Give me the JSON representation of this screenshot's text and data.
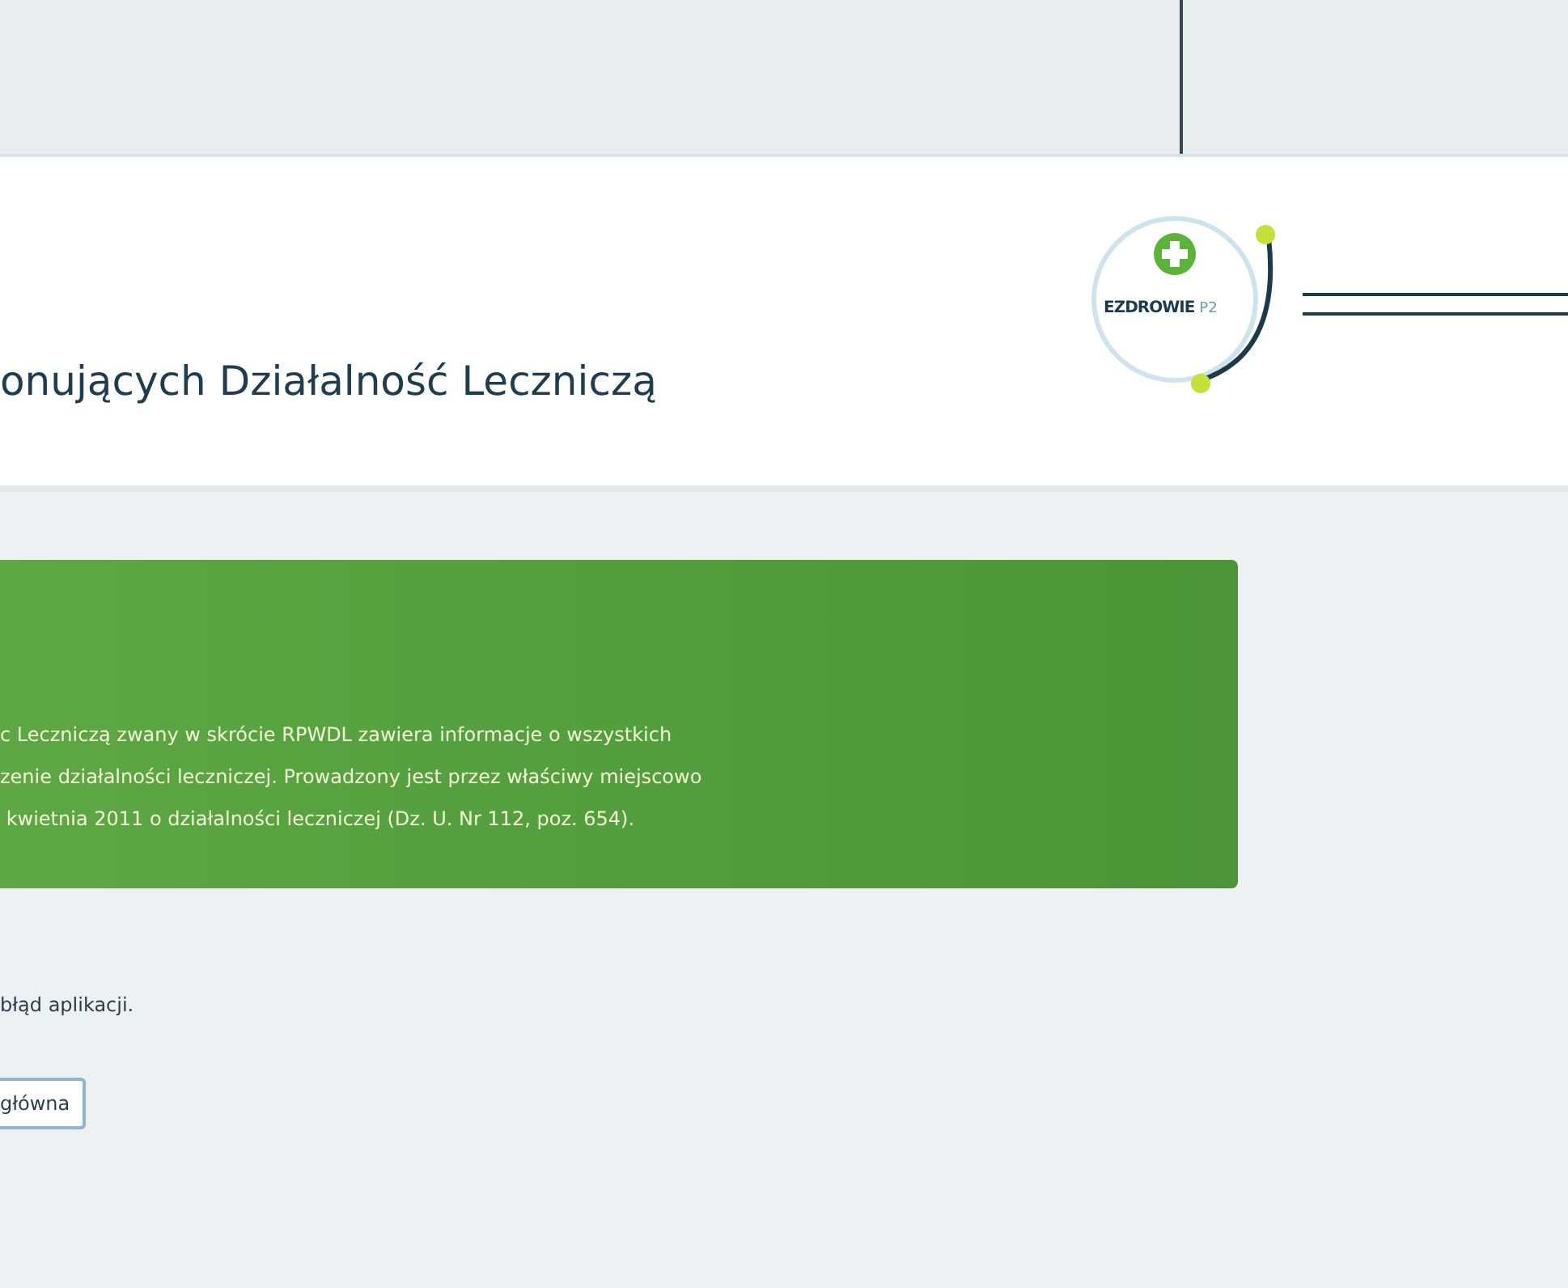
{
  "header": {
    "title": "onujących Działalność Leczniczą",
    "logo": {
      "text": "EZDROWIE",
      "suffix": "P2"
    }
  },
  "intro": {
    "lines": [
      "c Leczniczą zwany w skrócie RPWDL zawiera informacje o wszystkich",
      "zenie działalności leczniczej. Prowadzony jest przez właściwy miejscowo",
      " kwietnia 2011 o działalności leczniczej (Dz. U. Nr 112, poz. 654)."
    ]
  },
  "error": {
    "message": "błąd aplikacji."
  },
  "buttons": [
    {
      "label": "główna"
    }
  ]
}
